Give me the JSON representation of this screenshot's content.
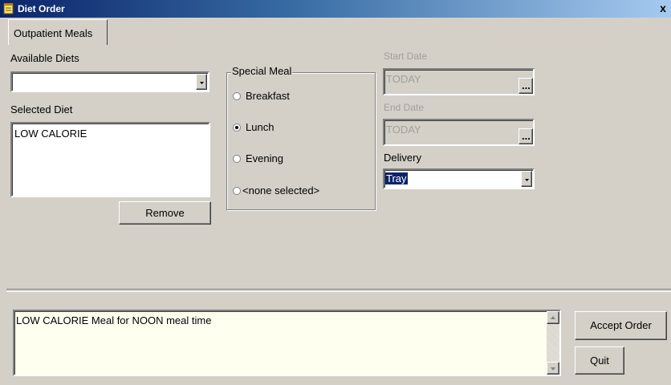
{
  "window": {
    "title": "Diet Order",
    "close_glyph": "x"
  },
  "tabs": [
    {
      "label": "Outpatient Meals"
    }
  ],
  "available_diets": {
    "label": "Available Diets",
    "value": ""
  },
  "selected_diet": {
    "label": "Selected Diet",
    "items": [
      "LOW CALORIE"
    ],
    "remove_label": "Remove"
  },
  "special_meal": {
    "label": "Special Meal",
    "options": [
      {
        "label": "Breakfast",
        "checked": false
      },
      {
        "label": "Lunch",
        "checked": true
      },
      {
        "label": "Evening",
        "checked": false
      },
      {
        "label": "<none selected>",
        "checked": false
      }
    ]
  },
  "start_date": {
    "label": "Start Date",
    "value": "TODAY",
    "button": "..."
  },
  "end_date": {
    "label": "End Date",
    "value": "TODAY",
    "button": "..."
  },
  "delivery": {
    "label": "Delivery",
    "value": "Tray"
  },
  "summary": {
    "text": "LOW CALORIE Meal for NOON meal time"
  },
  "buttons": {
    "accept": "Accept Order",
    "quit": "Quit"
  },
  "colors": {
    "selection": "#0a246a",
    "memo_bg": "#fffff0"
  }
}
